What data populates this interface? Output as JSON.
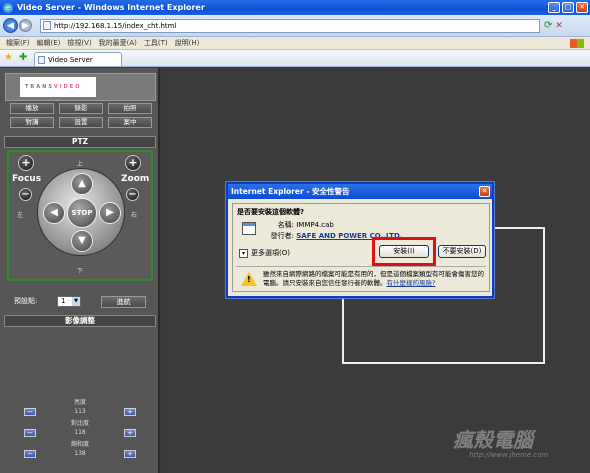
{
  "window": {
    "title": "Video Server - Windows Internet Explorer",
    "url": "http://192.168.1.15/index_cht.html",
    "tab_title": "Video Server"
  },
  "menu": [
    "檔案(F)",
    "編輯(E)",
    "檢視(V)",
    "我的最愛(A)",
    "工具(T)",
    "說明(H)"
  ],
  "panel": {
    "logo_text_a": "TRANS",
    "logo_text_b": "VIDEO",
    "buttons": [
      "播放",
      "錄影",
      "拍照",
      "對講",
      "設置",
      "案中"
    ],
    "ptz_header": "PTZ",
    "focus_label": "Focus",
    "zoom_label": "Zoom",
    "dir_up": "上",
    "dir_down": "下",
    "dir_left": "左",
    "dir_right": "右",
    "stop_label": "STOP",
    "plus": "+",
    "minus": "−",
    "preset_label": "預設點:",
    "preset_value": "1",
    "go_label": "進航",
    "image_header": "影像調整",
    "adjust": [
      {
        "name": "亮度",
        "value": "113"
      },
      {
        "name": "對比度",
        "value": "118"
      },
      {
        "name": "飽和度",
        "value": "138"
      }
    ],
    "adj_minus": "−",
    "adj_plus": "+"
  },
  "dialog": {
    "title": "Internet Explorer - 安全性警告",
    "question": "是否要安裝這個軟體?",
    "name_key": "名稱:",
    "name_value": "IMMP4.cab",
    "publisher_key": "發行者:",
    "publisher_value": "SAFE AND POWER CO.,LTD.",
    "more_options": "更多選項(O)",
    "install_button": "安裝(I)",
    "dont_install_button": "不要安裝(D)",
    "warning_text": "雖然來自網際網路的檔案可能是有用的，但是這個檔案類型有可能會傷害您的電腦。請只安裝來自您信任發行者的軟體。",
    "warning_link": "有什麼樣的風險?"
  },
  "watermark": {
    "main": "瘋殼電腦",
    "sub": "http://www.jheme.com"
  }
}
